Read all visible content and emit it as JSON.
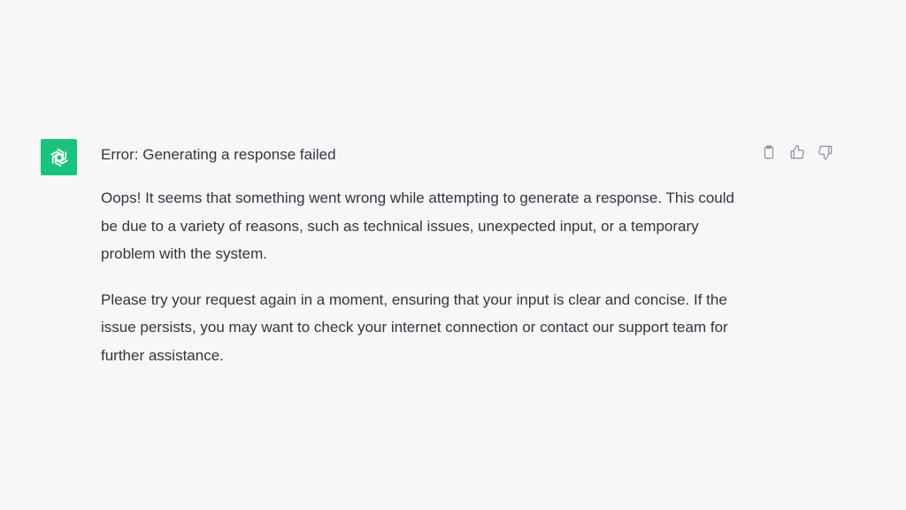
{
  "colors": {
    "background": "#f7f7f8",
    "avatar_bg": "#19c37d",
    "text": "#343541",
    "icon": "#8e8ea0"
  },
  "message": {
    "avatar_icon": "openai-logo-icon",
    "title": "Error: Generating a response failed",
    "paragraphs": [
      "Oops! It seems that something went wrong while attempting to generate a response. This could be due to a variety of reasons, such as technical issues, unexpected input, or a temporary problem with the system.",
      "Please try your request again in a moment, ensuring that your input is clear and concise. If the issue persists, you may want to check your internet connection or contact our support team for further assistance."
    ]
  },
  "actions": [
    {
      "icon": "clipboard-icon"
    },
    {
      "icon": "thumbs-up-icon"
    },
    {
      "icon": "thumbs-down-icon"
    }
  ]
}
